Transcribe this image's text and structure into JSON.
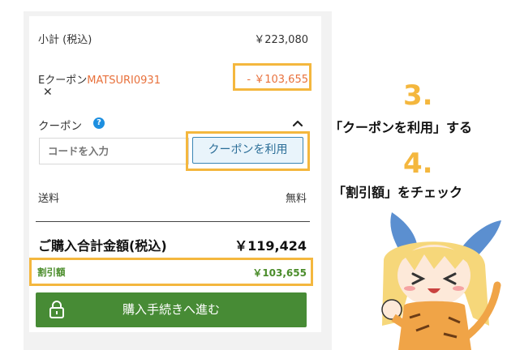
{
  "summary": {
    "subtotal_label": "小計 (税込)",
    "subtotal_value": "￥223,080",
    "coupon_prefix": "Eクーポン",
    "coupon_code": "MATSURI0931",
    "remove_symbol": "✕",
    "discount_value": "- ￥103,655"
  },
  "coupon_section": {
    "title": "クーポン",
    "help_symbol": "?",
    "input_placeholder": "コードを入力",
    "apply_label": "クーポンを利用"
  },
  "shipping": {
    "label": "送料",
    "value": "無料"
  },
  "total": {
    "label": "ご購入合計金額(税込)",
    "value": "￥119,424"
  },
  "waribiki": {
    "label": "割引額",
    "value": "￥103,655"
  },
  "checkout": {
    "label": "購入手続きへ進む"
  },
  "annotations": {
    "step3_num": "3.",
    "step3_text": "「クーポンを利用」する",
    "step4_num": "4.",
    "step4_text": "「割引額」をチェック"
  },
  "colors": {
    "highlight": "#f4b73e",
    "discount_orange": "#e8713c",
    "checkout_green": "#478b35",
    "apply_blue": "#2a6d97"
  }
}
